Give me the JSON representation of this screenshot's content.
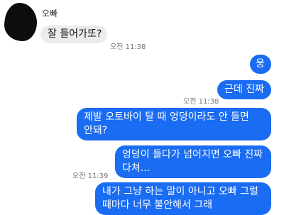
{
  "contact": {
    "name": "오빠"
  },
  "messages": [
    {
      "text": "잘 들어가또?"
    },
    {
      "time": "오전 11:38"
    },
    {
      "text": "웅"
    },
    {
      "text": "근데 진짜"
    },
    {
      "time": "오전 11:38"
    },
    {
      "lines": [
        "제발 오토바이 탈 때 엉덩이라도 안 들면",
        "안돼?"
      ]
    },
    {
      "lines": [
        "엉덩이 들다가 넘어지면 오빠 진짜",
        "다쳐..."
      ]
    },
    {
      "time": "오전 11:39"
    },
    {
      "lines": [
        "내가 그냥 하는 말이 아니고 오빠 그럴",
        "때마다 너무 불안해서 그래"
      ]
    }
  ],
  "colors": {
    "incoming_bubble": "#ececec",
    "outgoing_bubble": "#1a6cf2",
    "avatar": "#0d0d0d"
  }
}
